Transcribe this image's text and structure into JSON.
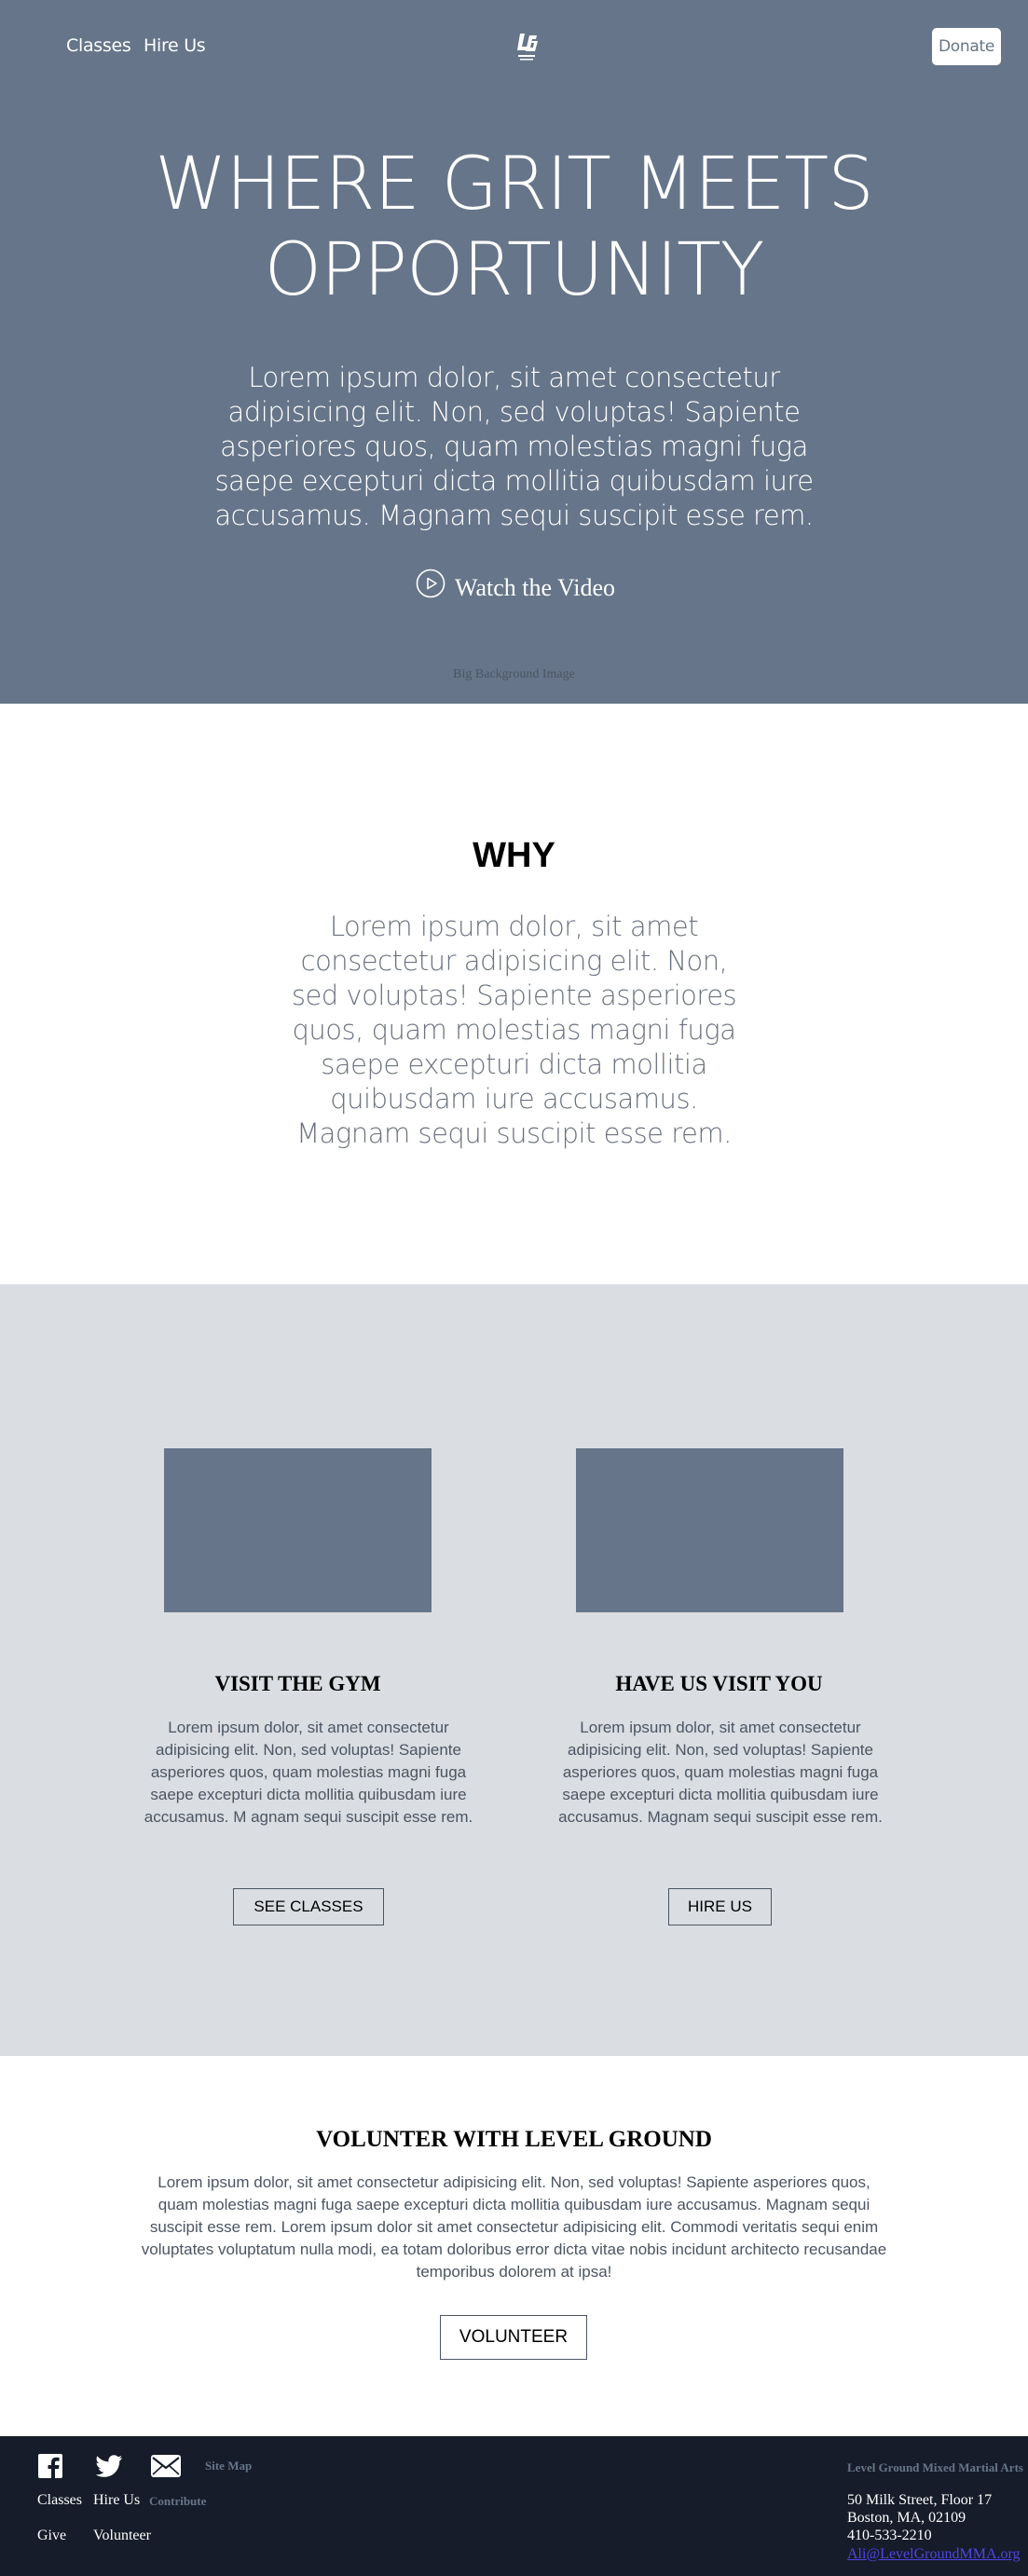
{
  "nav": {
    "classes": "Classes",
    "hire_us": "Hire Us",
    "logo_icon": "level-ground-logo-icon",
    "donate": "Donate"
  },
  "hero": {
    "title_line1": "WHERE GRIT MEETS",
    "title_line2": "OPPORTUNITY",
    "body": "Lorem ipsum dolor, sit amet consectetur adipisicing elit. Non, sed voluptas! Sapiente asperiores quos, quam molestias magni fuga saepe excepturi dicta mollitia quibusdam iure accusamus. Magnam sequi suscipit esse rem.",
    "watch_icon": "play-circle-icon",
    "watch_label": "Watch the Video",
    "bg_caption": "Big Background Image",
    "bg_color": "#667589"
  },
  "why": {
    "title": "WHY",
    "body": "Lorem ipsum dolor, sit amet consectetur adipisicing elit. Non, sed voluptas! Sapiente asperiores quos, quam molestias magni fuga saepe excepturi dicta mollitia quibusdam iure accusamus. Magnam sequi suscipit esse rem."
  },
  "cards": [
    {
      "title": "VISIT THE GYM",
      "body": "Lorem ipsum dolor, sit amet consectetur adipisicing elit. Non, sed voluptas! Sapiente asperiores quos, quam molestias magni fuga saepe excepturi dicta mollitia quibusdam iure accusamus. M agnam sequi suscipit esse rem.",
      "button": "SEE CLASSES"
    },
    {
      "title": "HAVE US VISIT YOU",
      "body": "Lorem ipsum dolor, sit amet consectetur adipisicing elit. Non, sed voluptas! Sapiente asperiores quos, quam molestias magni fuga saepe excepturi dicta mollitia quibusdam iure accusamus. Magnam sequi suscipit esse rem.",
      "button": "HIRE US"
    }
  ],
  "volunteer": {
    "title": "VOLUNTER WITH LEVEL GROUND",
    "body": "Lorem ipsum dolor, sit amet consectetur adipisicing elit. Non, sed voluptas! Sapiente asperiores quos, quam molestias magni fuga saepe excepturi dicta mollitia quibusdam iure accusamus. Magnam sequi suscipit esse rem. Lorem ipsum dolor sit amet consectetur adipisicing elit. Commodi veritatis sequi enim voluptates voluptatum nulla modi, ea totam doloribus error dicta vitae nobis incidunt architecto recusandae temporibus dolorem at ipsa!",
    "button": "VOLUNTEER"
  },
  "footer": {
    "social_icons": [
      "facebook-icon",
      "twitter-icon",
      "email-icon"
    ],
    "site_map": "Site Map",
    "links": {
      "classes": "Classes",
      "hire_us": "Hire Us",
      "contribute": "Contribute",
      "give": "Give",
      "volunteer": "Volunteer"
    },
    "org_name": "Level Ground Mixed Martial Arts",
    "address_line1": "50 Milk Street, Floor 17",
    "address_line2": "Boston, MA, 02109",
    "phone": "410-533-2210",
    "email": "Ali@LevelGroundMMA.org"
  }
}
